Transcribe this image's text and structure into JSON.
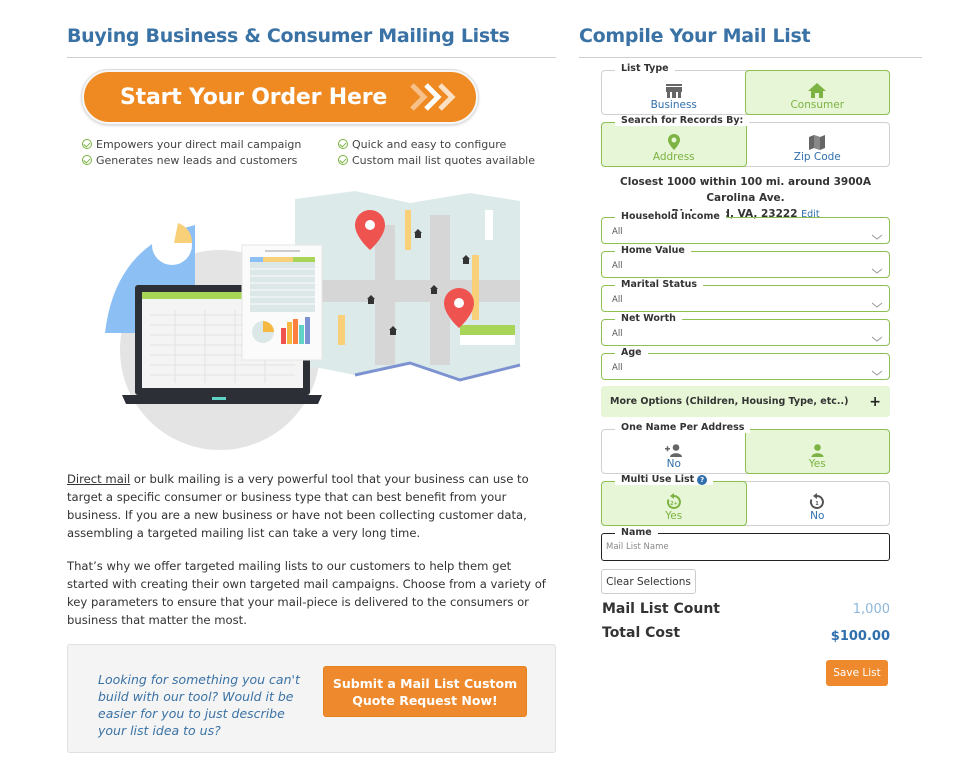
{
  "left": {
    "title": "Buying Business & Consumer Mailing Lists",
    "start_button": "Start Your Order Here",
    "features_col1": [
      "Empowers your direct mail campaign",
      "Generates new leads and customers"
    ],
    "features_col2": [
      "Quick and easy to configure",
      "Custom mail list quotes available"
    ],
    "paragraph1_link": "Direct mail",
    "paragraph1_rest": " or bulk mailing is a very powerful tool that your business can use to target a specific consumer or business type that can best benefit from your business. If you are a new business or have not been collecting customer data, assembling a targeted mailing list can take a very long time.",
    "paragraph2": "That’s why we offer targeted mailing lists to our customers to help them get started with creating their own targeted mail campaigns. Choose from a variety of key parameters to ensure that your mail-piece is delivered to the consumers or business that matter the most.",
    "quote_prompt": "Looking for something you can't build with our tool? Would it be easier for you to just describe your list idea to us?",
    "quote_button": "Submit a Mail List Custom Quote Request Now!"
  },
  "right": {
    "title": "Compile Your Mail List",
    "list_type": {
      "legend": "List Type",
      "options": [
        {
          "label": "Business",
          "icon": "store-icon",
          "selected": false
        },
        {
          "label": "Consumer",
          "icon": "home-icon",
          "selected": true
        }
      ]
    },
    "search_by": {
      "legend": "Search for Records By:",
      "options": [
        {
          "label": "Address",
          "icon": "map-marker-icon",
          "selected": true
        },
        {
          "label": "Zip Code",
          "icon": "map-icon",
          "selected": false
        }
      ]
    },
    "address_summary_line1": "Closest 1000 within 100 mi. around 3900A Carolina Ave.",
    "address_summary_line2": "Richmond, VA, 23222",
    "edit_link": "Edit",
    "filters": [
      {
        "label": "Household Income",
        "value": "All"
      },
      {
        "label": "Home Value",
        "value": "All"
      },
      {
        "label": "Marital Status",
        "value": "All"
      },
      {
        "label": "Net Worth",
        "value": "All"
      },
      {
        "label": "Age",
        "value": "All"
      }
    ],
    "more_options": "More Options (Children, Housing Type, etc..)",
    "more_options_icon": "+",
    "one_name": {
      "legend": "One Name Per Address",
      "options": [
        {
          "label": "No",
          "icon": "user-plus-icon",
          "selected": false
        },
        {
          "label": "Yes",
          "icon": "user-icon",
          "selected": true
        }
      ]
    },
    "multi_use": {
      "legend": "Multi Use List",
      "help_icon": "?",
      "options": [
        {
          "label": "Yes",
          "icon": "rotate-2plus-icon",
          "badge": "2+",
          "selected": true
        },
        {
          "label": "No",
          "icon": "rotate-1-icon",
          "badge": "1",
          "selected": false
        }
      ]
    },
    "name_field": {
      "legend": "Name",
      "placeholder": "Mail List Name",
      "value": ""
    },
    "clear_button": "Clear Selections",
    "count_label": "Mail List Count",
    "count_value": "1,000",
    "cost_label": "Total Cost",
    "cost_value": "$100.00",
    "save_button": "Save List"
  },
  "colors": {
    "heading_blue": "#3a72a5",
    "link_blue": "#2f6fae",
    "accent_orange": "#ee8a2d",
    "selected_green": "#7cb342",
    "selected_bg": "#e6f6d6"
  }
}
